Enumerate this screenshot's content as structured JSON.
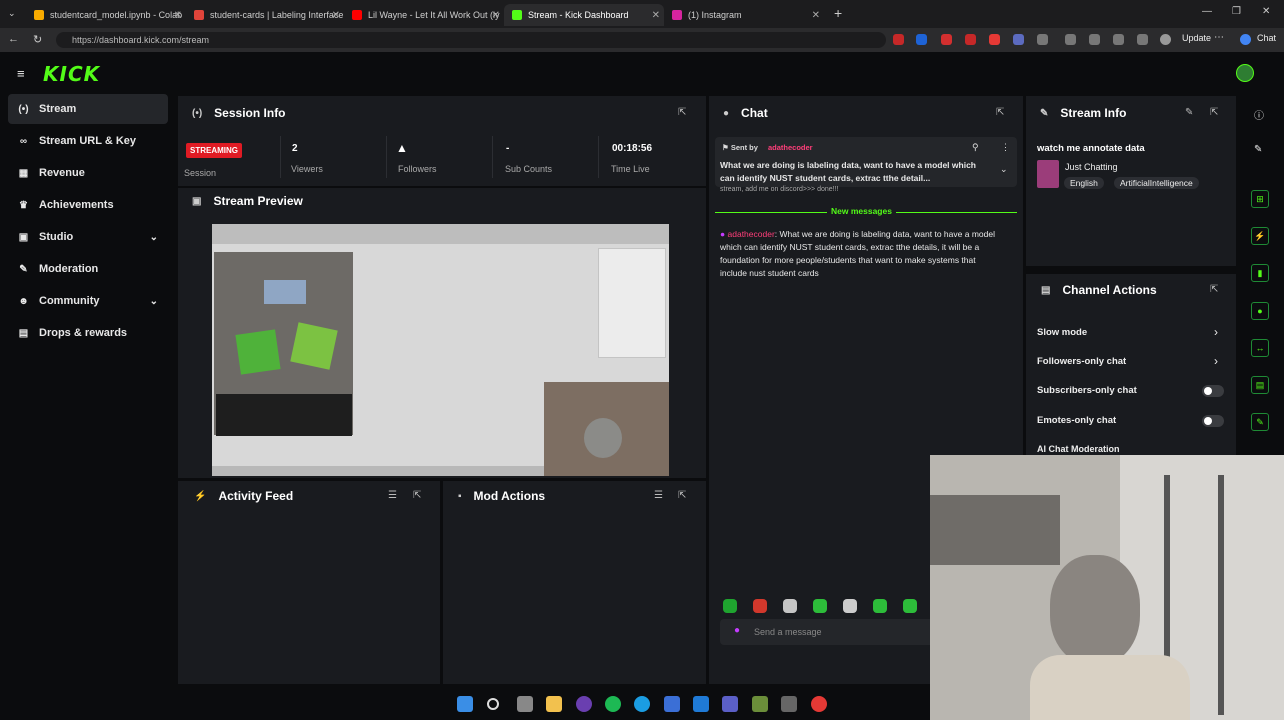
{
  "browser": {
    "tabs": [
      {
        "title": "studentcard_model.ipynb - Colab",
        "color": "#f9ab00"
      },
      {
        "title": "student-cards | Labeling Interface",
        "color": "#e0443a"
      },
      {
        "title": "Lil Wayne - Let It All Work Out (ly",
        "color": "#ff0000"
      },
      {
        "title": "Stream - Kick Dashboard",
        "color": "#53fc18"
      },
      {
        "title": "(1) Instagram",
        "color": "#d6249f"
      }
    ],
    "url": "https://dashboard.kick.com/stream",
    "update_label": "Update",
    "chat_label": "Chat"
  },
  "kick": {
    "logo": "KICK",
    "sidebar": [
      {
        "label": "Stream",
        "icon": "(•)"
      },
      {
        "label": "Stream URL & Key",
        "icon": "∞"
      },
      {
        "label": "Revenue",
        "icon": "▦"
      },
      {
        "label": "Achievements",
        "icon": "♛"
      },
      {
        "label": "Studio",
        "icon": "▣"
      },
      {
        "label": "Moderation",
        "icon": "✎"
      },
      {
        "label": "Community",
        "icon": "☻"
      },
      {
        "label": "Drops & rewards",
        "icon": "▤"
      }
    ],
    "session": {
      "title": "Session Info",
      "badge": "STREAMING",
      "session_label": "Session",
      "stats": [
        {
          "value": "2",
          "label": "Viewers"
        },
        {
          "value": "",
          "label": "Followers"
        },
        {
          "value": "-",
          "label": "Sub Counts"
        },
        {
          "value": "00:18:56",
          "label": "Time Live"
        }
      ]
    },
    "preview": {
      "title": "Stream Preview"
    },
    "activity": {
      "title": "Activity Feed"
    },
    "mod": {
      "title": "Mod Actions"
    },
    "chat": {
      "title": "Chat",
      "pinned_label": "Sent by",
      "pinned_user": "adathecoder",
      "pinned_text": "What we are doing is labeling data, want to have a model which can identify NUST student cards, extrac tthe detail...",
      "pinned_tail": "stream, add me on discord>>> done!!!",
      "new_messages": "New messages",
      "message_user": "adathecoder",
      "message_text": ": What we are doing is labeling data, want to have a model which can identify NUST student cards, extrac tthe details, it will be a foundation for more people/students that want to make systems that include nust student cards",
      "input_placeholder": "Send a message"
    },
    "stream_info": {
      "title": "Stream Info",
      "stream_title": "watch me annotate data",
      "category": "Just Chatting",
      "tags": [
        "English",
        "ArtificialIntelligence"
      ]
    },
    "channel_actions": {
      "title": "Channel Actions",
      "items": [
        {
          "label": "Slow mode"
        },
        {
          "label": "Followers-only chat"
        },
        {
          "label": "Subscribers-only chat"
        },
        {
          "label": "Emotes-only chat"
        },
        {
          "label": "AI Chat Moderation"
        }
      ]
    }
  },
  "colors": {
    "accent": "#53fc18",
    "live": "#e01b24",
    "username": "#ff3e7a"
  }
}
